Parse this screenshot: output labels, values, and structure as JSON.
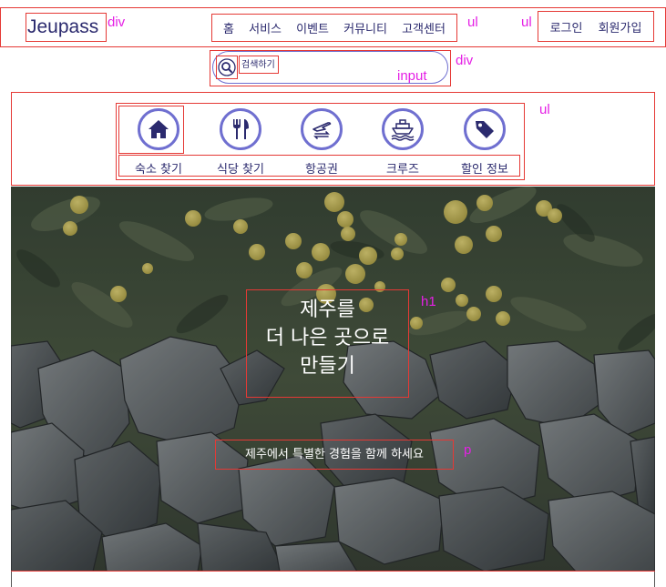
{
  "header": {
    "logo": "Jeupass",
    "logo_tag": "div",
    "nav_tag": "ul",
    "auth_tag": "ul",
    "nav": [
      {
        "label": "홈"
      },
      {
        "label": "서비스"
      },
      {
        "label": "이벤트"
      },
      {
        "label": "커뮤니티"
      },
      {
        "label": "고객센터"
      }
    ],
    "auth": [
      {
        "label": "로그인"
      },
      {
        "label": "회원가입"
      }
    ]
  },
  "search": {
    "placeholder": "검색하기",
    "input_tag": "input",
    "div_tag": "div",
    "icon": "search-icon"
  },
  "categories": {
    "tag": "ul",
    "items": [
      {
        "label": "숙소 찾기",
        "icon": "home-icon"
      },
      {
        "label": "식당 찾기",
        "icon": "fork-knife-icon"
      },
      {
        "label": "항공권",
        "icon": "airplane-ticket-icon"
      },
      {
        "label": "크루즈",
        "icon": "ship-icon"
      },
      {
        "label": "할인 정보",
        "icon": "tag-icon"
      }
    ]
  },
  "hero": {
    "title_lines": [
      "제주를",
      "더 나은 곳으로",
      "만들기"
    ],
    "title_tag": "h1",
    "subtitle": "제주에서 특별한 경험을 함께 하세요",
    "subtitle_tag": "p"
  },
  "colors": {
    "primary": "#2b2a6e",
    "accent": "#6f6fd0",
    "debug_outline": "#e53935",
    "debug_label": "#e520e5"
  }
}
